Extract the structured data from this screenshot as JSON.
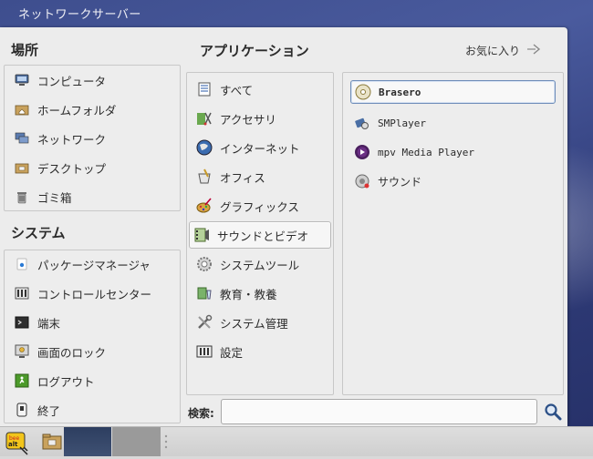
{
  "window": {
    "title": "ネットワークサーバー"
  },
  "places": {
    "heading": "場所",
    "items": [
      {
        "label": "コンピュータ",
        "icon": "computer-icon"
      },
      {
        "label": "ホームフォルダ",
        "icon": "home-folder-icon"
      },
      {
        "label": "ネットワーク",
        "icon": "network-icon"
      },
      {
        "label": "デスクトップ",
        "icon": "desktop-folder-icon"
      },
      {
        "label": "ゴミ箱",
        "icon": "trash-icon"
      }
    ]
  },
  "system": {
    "heading": "システム",
    "items": [
      {
        "label": "パッケージマネージャ",
        "icon": "package-manager-icon"
      },
      {
        "label": "コントロールセンター",
        "icon": "control-center-icon"
      },
      {
        "label": "端末",
        "icon": "terminal-icon"
      },
      {
        "label": "画面のロック",
        "icon": "lock-screen-icon"
      },
      {
        "label": "ログアウト",
        "icon": "logout-icon"
      },
      {
        "label": "終了",
        "icon": "shutdown-icon"
      }
    ]
  },
  "applications": {
    "heading": "アプリケーション",
    "favorites_label": "お気に入り",
    "categories": [
      {
        "label": "すべて",
        "icon": "all-apps-icon"
      },
      {
        "label": "アクセサリ",
        "icon": "accessories-icon"
      },
      {
        "label": "インターネット",
        "icon": "internet-globe-icon"
      },
      {
        "label": "オフィス",
        "icon": "office-icon"
      },
      {
        "label": "グラフィックス",
        "icon": "graphics-icon"
      },
      {
        "label": "サウンドとビデオ",
        "icon": "sound-video-icon",
        "selected": true
      },
      {
        "label": "システムツール",
        "icon": "system-tools-icon"
      },
      {
        "label": "教育・教養",
        "icon": "education-icon"
      },
      {
        "label": "システム管理",
        "icon": "system-admin-icon"
      },
      {
        "label": "設定",
        "icon": "settings-icon"
      }
    ],
    "apps": [
      {
        "label": "Brasero",
        "icon": "brasero-disc-icon",
        "selected": true
      },
      {
        "label": "SMPlayer",
        "icon": "smplayer-icon"
      },
      {
        "label": "mpv Media Player",
        "icon": "mpv-icon"
      },
      {
        "label": "サウンド",
        "icon": "sound-speaker-icon"
      }
    ]
  },
  "search": {
    "label": "検索:",
    "value": "",
    "placeholder": ""
  },
  "taskbar": {
    "menu_badge": "bee alt"
  },
  "colors": {
    "desktop": "#3e4e8e",
    "panel": "#ececec",
    "selection_border": "#6e8db8"
  }
}
